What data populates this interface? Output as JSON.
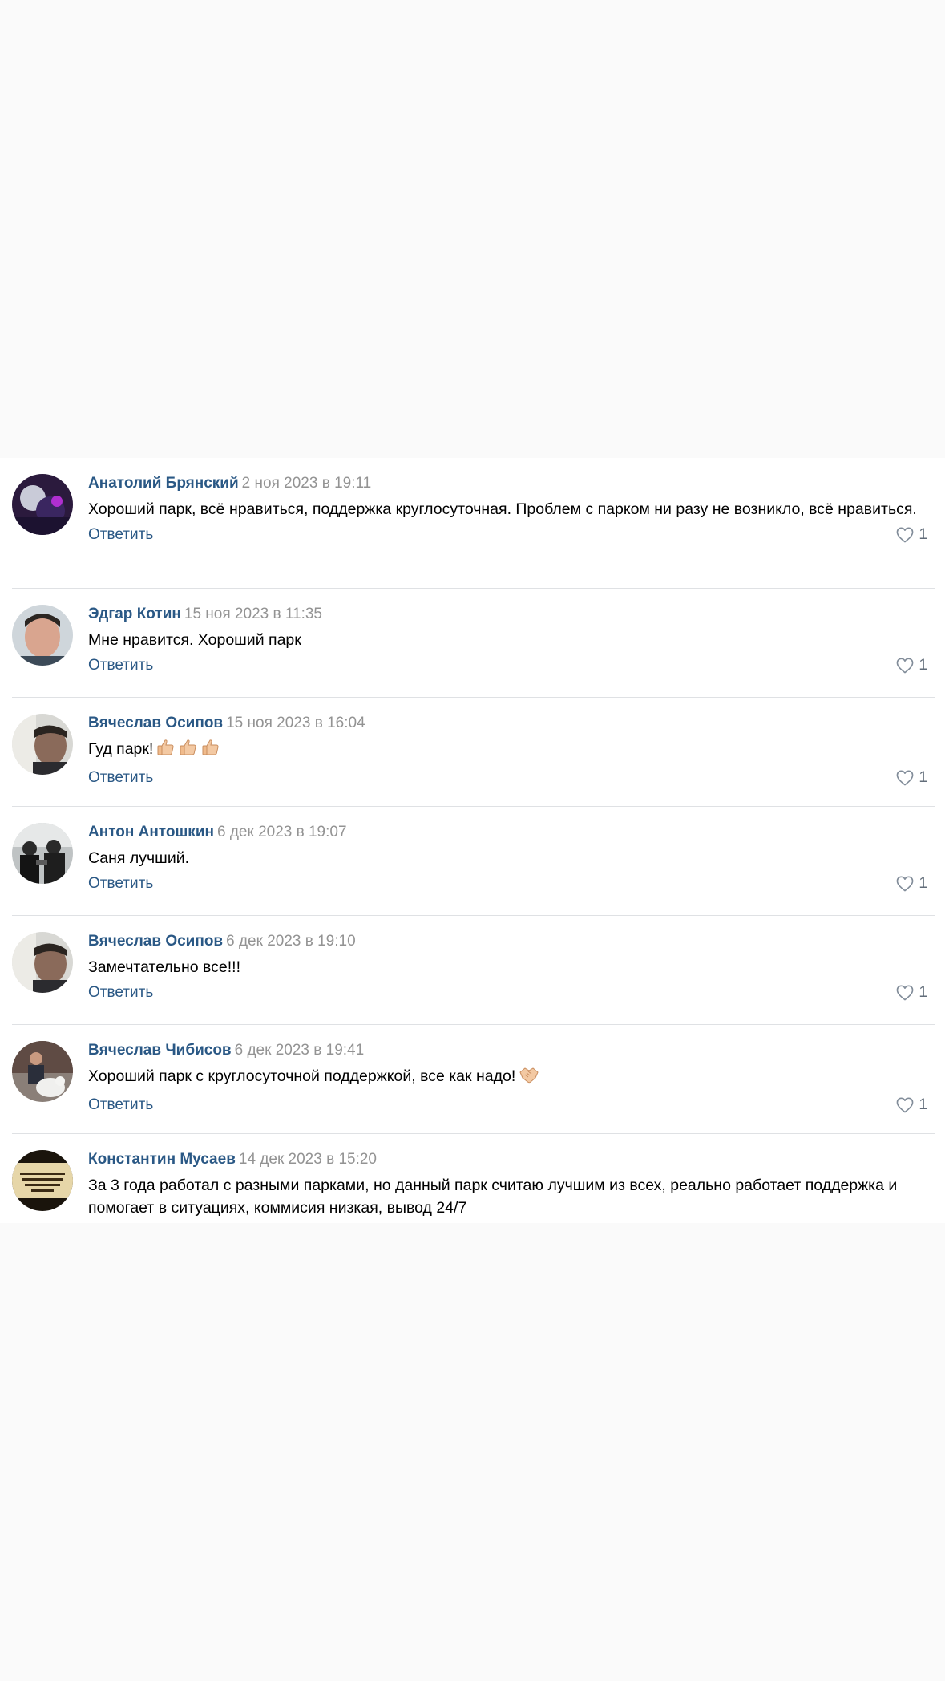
{
  "comments": [
    {
      "author": "Анатолий Брянский",
      "date": "2 ноя 2023 в 19:11",
      "text": "Хороший парк, всё нравиться, поддержка круглосуточная. Проблем с парком ни разу не возникло, всё нравиться.",
      "reply_label": "Ответить",
      "likes": "1"
    },
    {
      "author": "Эдгар Котин",
      "date": "15 ноя 2023 в 11:35",
      "text": "Мне нравится. Хороший парк",
      "reply_label": "Ответить",
      "likes": "1"
    },
    {
      "author": "Вячеслав Осипов",
      "date": "15 ноя 2023 в 16:04",
      "text": "Гуд парк!",
      "emoji": [
        "thumbs-up",
        "thumbs-up",
        "thumbs-up"
      ],
      "reply_label": "Ответить",
      "likes": "1"
    },
    {
      "author": "Антон Антошкин",
      "date": "6 дек 2023 в 19:07",
      "text": "Саня лучший.",
      "reply_label": "Ответить",
      "likes": "1"
    },
    {
      "author": "Вячеслав Осипов",
      "date": "6 дек 2023 в 19:10",
      "text": "Замечтательно все!!!",
      "reply_label": "Ответить",
      "likes": "1"
    },
    {
      "author": "Вячеслав Чибисов",
      "date": "6 дек 2023 в 19:41",
      "text": "Хороший парк с круглосуточной поддержкой, все как надо!",
      "emoji": [
        "handshake"
      ],
      "reply_label": "Ответить",
      "likes": "1"
    },
    {
      "author": "Константин Мусаев",
      "date": "14 дек 2023 в 15:20",
      "text": "За 3 года работал с разными парками, но данный парк считаю лучшим из всех, реально работает поддержка и помогает в ситуациях, коммисия низкая, вывод 24/7"
    }
  ],
  "icons": {
    "like": "heart-outline-icon",
    "thumbs": "thumbs-up-icon",
    "handshake": "handshake-icon"
  },
  "colors": {
    "author": "#2a5885",
    "date": "#939393",
    "link": "#2a5885",
    "divider": "#dfe1e4",
    "background": "#fafafa"
  }
}
